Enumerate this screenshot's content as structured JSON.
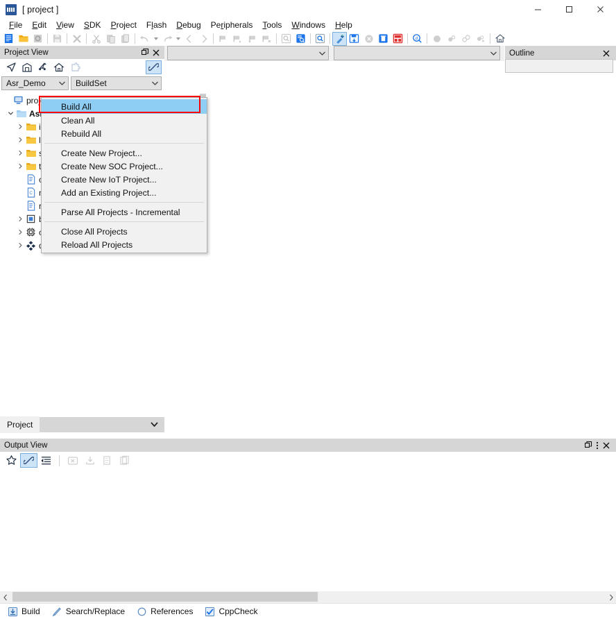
{
  "window": {
    "title": "[ project ]",
    "app_icon": "cdk-logo-icon",
    "minimize": "minimize-icon",
    "maximize": "maximize-icon",
    "close": "close-icon"
  },
  "menubar": {
    "items": [
      {
        "label": "File",
        "mnemonic": "F"
      },
      {
        "label": "Edit",
        "mnemonic": "E"
      },
      {
        "label": "View",
        "mnemonic": "V"
      },
      {
        "label": "SDK",
        "mnemonic": "S"
      },
      {
        "label": "Project",
        "mnemonic": "P"
      },
      {
        "label": "Flash",
        "mnemonic": "l"
      },
      {
        "label": "Debug",
        "mnemonic": "D"
      },
      {
        "label": "Peripherals",
        "mnemonic": "r"
      },
      {
        "label": "Tools",
        "mnemonic": "T"
      },
      {
        "label": "Windows",
        "mnemonic": "W"
      },
      {
        "label": "Help",
        "mnemonic": "H"
      }
    ]
  },
  "toolbar": {
    "buttons": [
      {
        "name": "new-file-icon",
        "enabled": true
      },
      {
        "name": "open-folder-icon",
        "enabled": true
      },
      {
        "name": "refresh-icon",
        "enabled": false
      },
      {
        "name": "save-icon",
        "enabled": false
      },
      {
        "name": "close-file-icon",
        "enabled": false
      },
      {
        "name": "cut-icon",
        "enabled": false
      },
      {
        "name": "copy-icon",
        "enabled": false
      },
      {
        "name": "paste-icon",
        "enabled": false
      },
      {
        "name": "undo-icon",
        "enabled": false
      },
      {
        "name": "redo-icon",
        "enabled": false
      },
      {
        "name": "navigate-back-icon",
        "enabled": false
      },
      {
        "name": "navigate-forward-icon",
        "enabled": false
      },
      {
        "name": "bookmark-toggle-icon",
        "enabled": false
      },
      {
        "name": "bookmark-next-icon",
        "enabled": false
      },
      {
        "name": "bookmark-prev-icon",
        "enabled": false
      },
      {
        "name": "bookmark-clear-icon",
        "enabled": false
      },
      {
        "name": "find-icon",
        "enabled": false
      },
      {
        "name": "find-in-files-icon",
        "enabled": true
      },
      {
        "name": "find-replace-icon",
        "enabled": true
      },
      {
        "name": "build-icon",
        "enabled": true,
        "selected": true
      },
      {
        "name": "flash-download-icon",
        "enabled": true
      },
      {
        "name": "stop-icon",
        "enabled": false
      },
      {
        "name": "clean-icon",
        "enabled": true
      },
      {
        "name": "debug-icon",
        "enabled": true
      },
      {
        "name": "debug-query-icon",
        "enabled": true
      },
      {
        "name": "breakpoint-icon",
        "enabled": false
      },
      {
        "name": "breakpoint-disable-icon",
        "enabled": false
      },
      {
        "name": "breakpoint-all-icon",
        "enabled": false
      },
      {
        "name": "breakpoint-remove-icon",
        "enabled": false
      },
      {
        "name": "home-icon",
        "enabled": true
      }
    ]
  },
  "top_combos": {
    "target_value": "",
    "config_value": ""
  },
  "project_view": {
    "title": "Project View",
    "float_icon": "float-restore-icon",
    "close_icon": "close-icon",
    "toolbar": [
      {
        "name": "locate-icon"
      },
      {
        "name": "repository-icon"
      },
      {
        "name": "expand-tree-icon"
      },
      {
        "name": "home-icon"
      },
      {
        "name": "puzzle-icon"
      },
      {
        "name": "link-editor-icon",
        "active": true
      }
    ],
    "project_combo": "Asr_Demo",
    "buildset_combo": "BuildSet",
    "tree": [
      {
        "depth": 0,
        "icon": "workspace-icon",
        "label": "project",
        "expander": "none",
        "bold": false
      },
      {
        "depth": 1,
        "icon": "folder-open-icon",
        "label": "Asr",
        "expander": "expanded",
        "bold": true
      },
      {
        "depth": 2,
        "icon": "folder-icon",
        "label": "i",
        "expander": "collapsed",
        "bold": false
      },
      {
        "depth": 2,
        "icon": "folder-icon",
        "label": "l",
        "expander": "collapsed",
        "bold": false
      },
      {
        "depth": 2,
        "icon": "folder-icon",
        "label": "s",
        "expander": "collapsed",
        "bold": false
      },
      {
        "depth": 2,
        "icon": "folder-icon",
        "label": "t",
        "expander": "collapsed",
        "bold": false
      },
      {
        "depth": 2,
        "icon": "text-file-icon",
        "label": "c",
        "expander": "none",
        "bold": false
      },
      {
        "depth": 2,
        "icon": "c-file-icon",
        "label": "m",
        "expander": "none",
        "bold": false
      },
      {
        "depth": 2,
        "icon": "text-file-icon",
        "label": "r",
        "expander": "none",
        "bold": false
      },
      {
        "depth": 2,
        "icon": "chip-icon",
        "label": "b",
        "expander": "collapsed",
        "bold": false
      },
      {
        "depth": 2,
        "icon": "cpu-icon",
        "label": "c",
        "expander": "collapsed",
        "bold": false
      },
      {
        "depth": 2,
        "icon": "package-icon",
        "label": "d",
        "expander": "collapsed",
        "bold": false
      }
    ],
    "bottom_tab": "Project",
    "bottom_combo": ""
  },
  "outline": {
    "title": "Outline",
    "close_icon": "close-icon",
    "field_value": ""
  },
  "context_menu": {
    "groups": [
      [
        {
          "label": "Build All",
          "selected": true,
          "highlighted": true
        },
        {
          "label": "Clean All",
          "selected": false
        },
        {
          "label": "Rebuild All",
          "selected": false
        }
      ],
      [
        {
          "label": "Create New Project...",
          "selected": false
        },
        {
          "label": "Create New SOC Project...",
          "selected": false
        },
        {
          "label": "Create New IoT Project...",
          "selected": false
        },
        {
          "label": "Add an Existing Project...",
          "selected": false
        }
      ],
      [
        {
          "label": "Parse All Projects - Incremental",
          "selected": false
        }
      ],
      [
        {
          "label": "Close All Projects",
          "selected": false
        },
        {
          "label": "Reload All Projects",
          "selected": false
        }
      ]
    ]
  },
  "output_view": {
    "title": "Output View",
    "float_icon": "float-restore-icon",
    "menu_icon": "more-options-icon",
    "close_icon": "close-icon",
    "toolbar": [
      {
        "name": "favorite-star-icon",
        "enabled": true
      },
      {
        "name": "link-icon",
        "enabled": true,
        "active": true
      },
      {
        "name": "wrap-lines-icon",
        "enabled": true
      },
      {
        "name": "clear-output-icon",
        "enabled": false
      },
      {
        "name": "save-output-icon",
        "enabled": false
      },
      {
        "name": "copy-output-icon",
        "enabled": false
      },
      {
        "name": "paste-output-icon",
        "enabled": false
      }
    ],
    "content": ""
  },
  "bottom_tabs": [
    {
      "label": "Build",
      "icon": "download-arrow-icon",
      "active": true
    },
    {
      "label": "Search/Replace",
      "icon": "pencil-icon",
      "active": false
    },
    {
      "label": "References",
      "icon": "circle-icon",
      "active": false
    },
    {
      "label": "CppCheck",
      "icon": "checkbox-checked-icon",
      "active": false
    }
  ],
  "scrollbars": {
    "h_left_arrow": "chevron-left-icon",
    "h_right_arrow": "chevron-right-icon"
  },
  "colors": {
    "accent_blue": "#2b579a",
    "selection_blue": "#8ecdf4",
    "highlight_box_red": "#fb0007",
    "panel_header_gray": "#d6d6d6",
    "folder_yellow": "#f5c342"
  }
}
